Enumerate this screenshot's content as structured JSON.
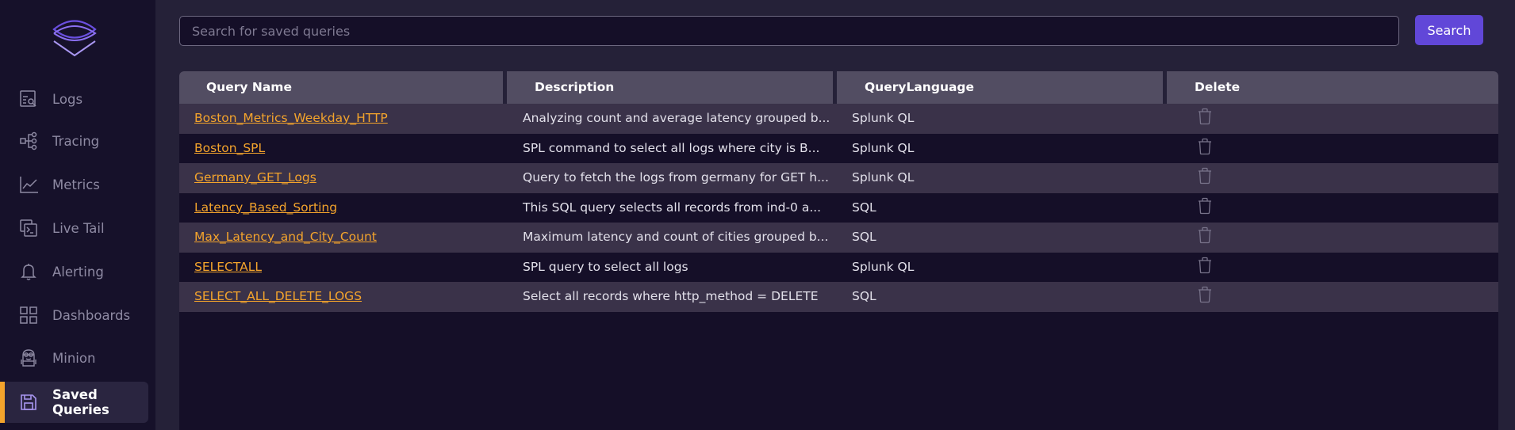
{
  "sidebar": {
    "logo": "logo-icon",
    "items": [
      {
        "label": "Logs",
        "icon": "logs-search-icon",
        "active": false
      },
      {
        "label": "Tracing",
        "icon": "tracing-tree-icon",
        "active": false
      },
      {
        "label": "Metrics",
        "icon": "metrics-chart-icon",
        "active": false
      },
      {
        "label": "Live Tail",
        "icon": "terminal-icon",
        "active": false
      },
      {
        "label": "Alerting",
        "icon": "bell-icon",
        "active": false
      },
      {
        "label": "Dashboards",
        "icon": "grid-icon",
        "active": false
      },
      {
        "label": "Minion",
        "icon": "minion-icon",
        "active": false
      },
      {
        "label": "Saved Queries",
        "icon": "save-icon",
        "active": true
      }
    ]
  },
  "search": {
    "placeholder": "Search for saved queries",
    "value": "",
    "button_label": "Search"
  },
  "table": {
    "columns": [
      "Query Name",
      "Description",
      "QueryLanguage",
      "Delete"
    ],
    "rows": [
      {
        "name": "Boston_Metrics_Weekday_HTTP",
        "description": "Analyzing count and average latency grouped b...",
        "language": "Splunk QL"
      },
      {
        "name": "Boston_SPL",
        "description": "SPL command to select all logs where city is B...",
        "language": "Splunk QL"
      },
      {
        "name": "Germany_GET_Logs",
        "description": "Query to fetch the logs from germany for GET h...",
        "language": "Splunk QL"
      },
      {
        "name": "Latency_Based_Sorting",
        "description": "This SQL query selects all records from ind-0 a...",
        "language": "SQL"
      },
      {
        "name": "Max_Latency_and_City_Count",
        "description": "Maximum latency and count of cities grouped b...",
        "language": "SQL"
      },
      {
        "name": "SELECTALL",
        "description": "SPL query to select all logs",
        "language": "Splunk QL"
      },
      {
        "name": "SELECT_ALL_DELETE_LOGS",
        "description": "Select all records where http_method = DELETE",
        "language": "SQL"
      }
    ]
  },
  "colors": {
    "accent": "#6147d8",
    "link": "#f4a42c",
    "active_indicator": "#f4a42c"
  }
}
